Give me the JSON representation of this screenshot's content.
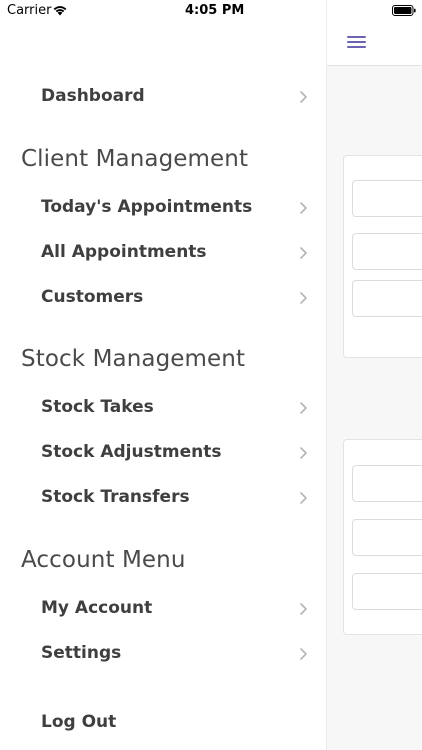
{
  "status_bar": {
    "carrier": "Carrier",
    "time": "4:05 PM"
  },
  "menu": {
    "dashboard": "Dashboard",
    "sections": [
      {
        "title": "Client Management",
        "items": [
          "Today's Appointments",
          "All Appointments",
          "Customers"
        ]
      },
      {
        "title": "Stock Management",
        "items": [
          "Stock Takes",
          "Stock Adjustments",
          "Stock Transfers"
        ]
      },
      {
        "title": "Account Menu",
        "items": [
          "My Account",
          "Settings"
        ]
      }
    ],
    "logout": "Log Out"
  },
  "colors": {
    "accent": "#6a63b0",
    "text": "#3f3f3f",
    "chevron": "#b5b5b5",
    "panel_bg": "#f7f7f7"
  },
  "icons": {
    "menu": "hamburger-icon",
    "chevron": "chevron-right-icon",
    "wifi": "wifi-icon",
    "battery": "battery-icon"
  }
}
